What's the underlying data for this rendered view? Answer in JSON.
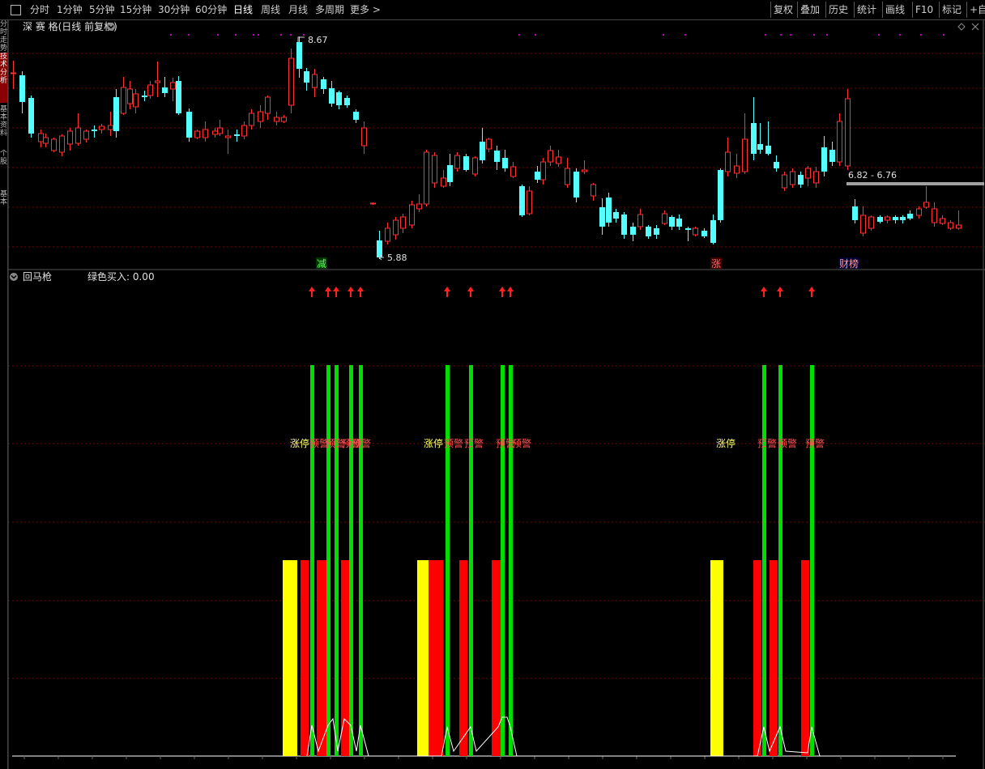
{
  "toolbar": {
    "periods": [
      "分时",
      "1分钟",
      "5分钟",
      "15分钟",
      "30分钟",
      "60分钟",
      "日线",
      "周线",
      "月线",
      "多周期",
      "更多 >"
    ],
    "active_period": "日线",
    "right_buttons": [
      "复权",
      "叠加",
      "历史",
      "统计",
      "画线",
      "F10",
      "标记",
      "+自"
    ]
  },
  "sidebar": {
    "tabs": [
      "分时走势",
      "技术分析",
      "基本资料",
      "个股",
      "基本"
    ]
  },
  "price_panel": {
    "title": "深 赛 格(日线 前复权)",
    "high_label": "8.67",
    "low_label": "5.88",
    "range_label": "6.82 - 6.76",
    "event_markers": [
      "减",
      "涨",
      "财榜"
    ]
  },
  "indicator_panel": {
    "title": "回马枪",
    "readout": "绿色买入: 0.00",
    "labels": {
      "zhangting": "涨停",
      "yujing": "预警"
    }
  },
  "colors": {
    "up": "#ff3232",
    "down": "#54ffff",
    "grid": "#7a0000",
    "yellow": "#ffff00",
    "green": "#00dd00",
    "red": "#ff0000",
    "white": "#ffffff",
    "purple": "#c000c0"
  }
}
